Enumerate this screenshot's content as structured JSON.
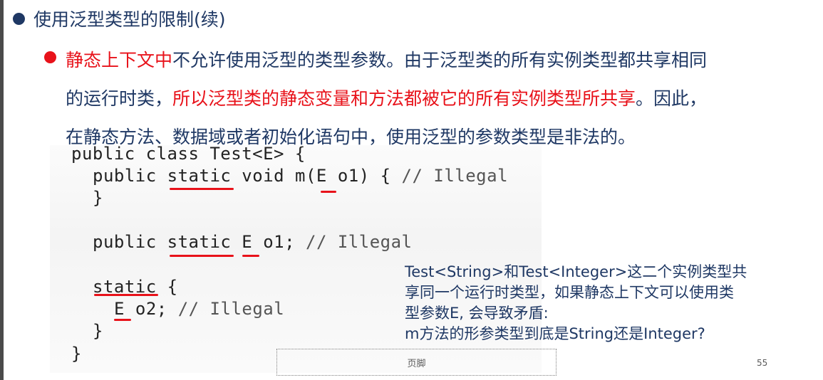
{
  "slide": {
    "title": "使用泛型类型的限制(续)",
    "paragraph": {
      "line1_red": "静态上下文中",
      "line1_rest": "不允许使用泛型的类型参数。由于泛型类的所有实例类型都共享相同",
      "line2_pre": "的运行时类，",
      "line2_red": "所以泛型类的静态变量和方法都被它的所有实例类型所共享",
      "line2_post": "。因此，",
      "line3": "在静态方法、数据域或者初始化语句中，使用泛型的参数类型是非法的。"
    },
    "code": {
      "l1": "public class Test<E> {",
      "l2_code": "public static void m(E o1) {",
      "l2_comment": "// Illegal",
      "l3": "}",
      "l4_code": "public static E o1;",
      "l4_comment": "// Illegal",
      "l5": "static {",
      "l6_code": "E o2;",
      "l6_comment": "// Illegal",
      "l7": "}",
      "l8": "}"
    },
    "note": {
      "line1": "Test<String>和Test<Integer>这二个实例类型共",
      "line2": "享同一个运行时类型，如果静态上下文可以使用类",
      "line3": "型参数E, 会导致矛盾:",
      "line4": "m方法的形参类型到底是String还是Integer?"
    },
    "footer": "页脚",
    "page_number": "55"
  },
  "colors": {
    "accent_red": "#e8121a",
    "text_navy": "#1f3864"
  }
}
